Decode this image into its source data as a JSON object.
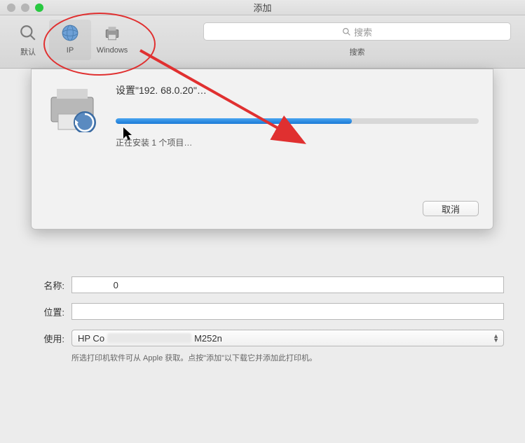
{
  "window": {
    "title": "添加"
  },
  "toolbar": {
    "tabs": [
      {
        "id": "default",
        "label": "默认"
      },
      {
        "id": "ip",
        "label": "IP"
      },
      {
        "id": "windows",
        "label": "Windows"
      }
    ],
    "search": {
      "placeholder": "搜索",
      "caption": "搜索"
    }
  },
  "sheet": {
    "title_prefix": "设置\"",
    "title_ip": "192.  68.0.20",
    "title_suffix": "\"…",
    "status": "正在安装 1 个项目…",
    "progress_percent": 65,
    "cancel_label": "取消"
  },
  "form": {
    "name_label": "名称:",
    "name_value": "              0",
    "location_label": "位置:",
    "location_value": "",
    "use_label": "使用:",
    "use_value_part1": "HP Co",
    "use_value_part2": "M252n",
    "help_text": "所选打印机软件可从 Apple 获取。点按\"添加\"以下载它并添加此打印机。"
  }
}
